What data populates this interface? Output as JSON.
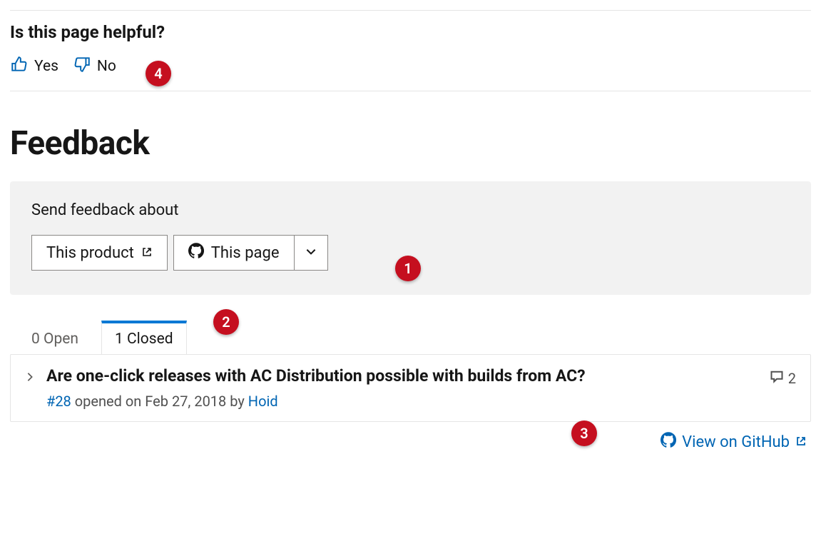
{
  "helpful": {
    "title": "Is this page helpful?",
    "yes_label": "Yes",
    "no_label": "No"
  },
  "feedback": {
    "heading": "Feedback",
    "send_about": "Send feedback about",
    "product_btn": "This product",
    "page_btn": "This page"
  },
  "tabs": {
    "open_label": "0 Open",
    "closed_label": "1 Closed"
  },
  "issue": {
    "title": "Are one-click releases with AC Distribution possible with builds from AC?",
    "number": "#28",
    "opened_text": " opened on Feb 27, 2018 by ",
    "author": "Hoid",
    "comment_count": "2"
  },
  "footer": {
    "view_on_github": "View on GitHub"
  },
  "annotations": {
    "a1": "1",
    "a2": "2",
    "a3": "3",
    "a4": "4"
  }
}
